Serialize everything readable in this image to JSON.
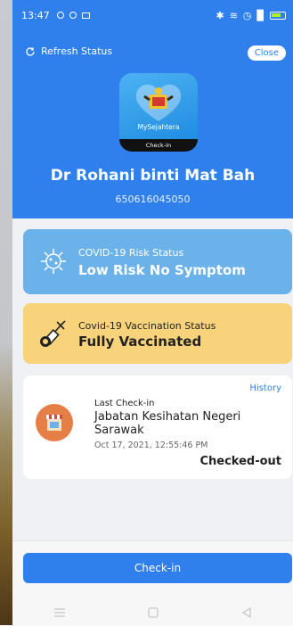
{
  "statusbar": {
    "time": "13:47"
  },
  "header": {
    "refresh_label": "Refresh Status",
    "close_label": "Close",
    "logo": {
      "brand": "MySejahtera",
      "badge": "Check-In"
    },
    "name": "Dr Rohani binti Mat Bah",
    "id_number": "650616045050"
  },
  "risk": {
    "label": "COVID-19 Risk Status",
    "value": "Low Risk No Symptom"
  },
  "vaccination": {
    "label": "Covid-19 Vaccination Status",
    "value": "Fully Vaccinated"
  },
  "last_checkin": {
    "history_label": "History",
    "label": "Last Check-in",
    "place": "Jabatan Kesihatan Negeri Sarawak",
    "datetime": "Oct 17, 2021, 12:55:46 PM",
    "status": "Checked-out"
  },
  "checkin_button": "Check-in",
  "navbar": {
    "icons": [
      "menu-icon",
      "home-square-icon",
      "back-triangle-icon"
    ]
  },
  "colors": {
    "primary": "#2f80ed",
    "risk_card": "#6cb2ea",
    "vaccine_card": "#f8d37b",
    "shop_icon": "#e57f45"
  }
}
